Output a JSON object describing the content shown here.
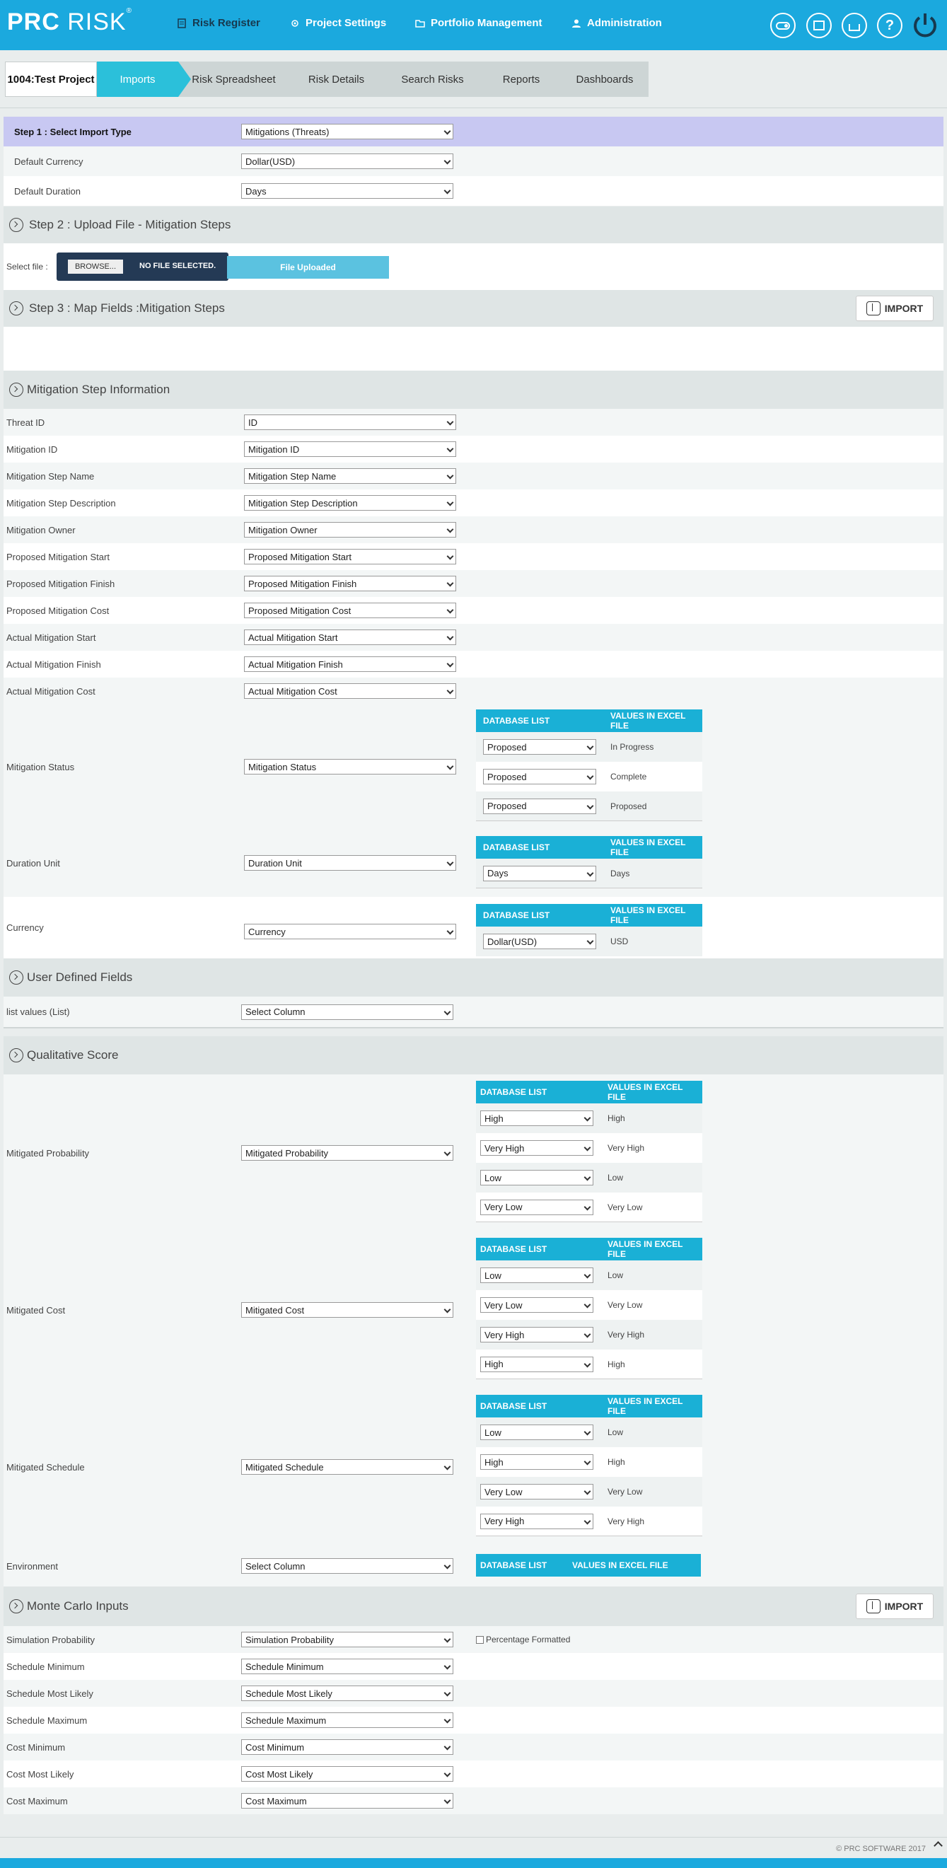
{
  "app": {
    "logo_bold": "PRC",
    "logo_light": "RISK",
    "logo_reg": "®"
  },
  "nav": [
    {
      "label": "Risk Register"
    },
    {
      "label": "Project Settings"
    },
    {
      "label": "Portfolio Management"
    },
    {
      "label": "Administration"
    }
  ],
  "breadcrumb": {
    "project": "1004:Test Project",
    "tabs": [
      "Imports",
      "Risk Spreadsheet",
      "Risk Details",
      "Search Risks",
      "Reports",
      "Dashboards"
    ]
  },
  "step1": {
    "title": "Step 1 : Select Import Type",
    "import_type": "Mitigations (Threats)",
    "currency_label": "Default Currency",
    "currency": "Dollar(USD)",
    "duration_label": "Default Duration",
    "duration": "Days"
  },
  "step2": {
    "title": "Step 2 : Upload File - Mitigation Steps",
    "select_file_label": "Select file :",
    "browse": "BROWSE...",
    "no_file": "NO FILE SELECTED.",
    "uploaded": "File Uploaded"
  },
  "step3": {
    "title": "Step 3 : Map Fields :Mitigation Steps",
    "import": "IMPORT"
  },
  "mitigation_info": {
    "title": "Mitigation Step Information",
    "fields": [
      {
        "label": "Threat ID",
        "value": "ID"
      },
      {
        "label": "Mitigation ID",
        "value": "Mitigation ID"
      },
      {
        "label": "Mitigation Step Name",
        "value": "Mitigation Step Name"
      },
      {
        "label": "Mitigation Step Description",
        "value": "Mitigation Step Description"
      },
      {
        "label": "Mitigation Owner",
        "value": "Mitigation Owner"
      },
      {
        "label": "Proposed Mitigation Start",
        "value": "Proposed Mitigation Start"
      },
      {
        "label": "Proposed Mitigation Finish",
        "value": "Proposed Mitigation Finish"
      },
      {
        "label": "Proposed Mitigation Cost",
        "value": "Proposed Mitigation Cost"
      },
      {
        "label": "Actual Mitigation Start",
        "value": "Actual Mitigation Start"
      },
      {
        "label": "Actual Mitigation Finish",
        "value": "Actual Mitigation Finish"
      },
      {
        "label": "Actual Mitigation Cost",
        "value": "Actual Mitigation Cost"
      }
    ],
    "status": {
      "label": "Mitigation Status",
      "value": "Mitigation Status",
      "map": [
        [
          "Proposed",
          "In Progress"
        ],
        [
          "Proposed",
          "Complete"
        ],
        [
          "Proposed",
          "Proposed"
        ]
      ]
    },
    "duration_unit": {
      "label": "Duration Unit",
      "value": "Duration Unit",
      "map": [
        [
          "Days",
          "Days"
        ]
      ]
    },
    "currency": {
      "label": "Currency",
      "value": "Currency",
      "map": [
        [
          "Dollar(USD)",
          "USD"
        ]
      ]
    }
  },
  "map_headers": {
    "db": "DATABASE LIST",
    "excel": "VALUES IN EXCEL FILE"
  },
  "udf": {
    "title": "User Defined Fields",
    "fields": [
      {
        "label": "list values (List)",
        "value": "Select Column"
      }
    ]
  },
  "qualitative": {
    "title": "Qualitative Score",
    "probability": {
      "label": "Mitigated Probability",
      "value": "Mitigated Probability",
      "map": [
        [
          "High",
          "High"
        ],
        [
          "Very High",
          "Very High"
        ],
        [
          "Low",
          "Low"
        ],
        [
          "Very Low",
          "Very Low"
        ]
      ]
    },
    "cost": {
      "label": "Mitigated Cost",
      "value": "Mitigated Cost",
      "map": [
        [
          "Low",
          "Low"
        ],
        [
          "Very Low",
          "Very Low"
        ],
        [
          "Very High",
          "Very High"
        ],
        [
          "High",
          "High"
        ]
      ]
    },
    "schedule": {
      "label": "Mitigated Schedule",
      "value": "Mitigated Schedule",
      "map": [
        [
          "Low",
          "Low"
        ],
        [
          "High",
          "High"
        ],
        [
          "Very Low",
          "Very Low"
        ],
        [
          "Very High",
          "Very High"
        ]
      ]
    },
    "environment": {
      "label": "Environment",
      "value": "Select Column"
    }
  },
  "monte_carlo": {
    "title": "Monte Carlo Inputs",
    "import": "IMPORT",
    "pct_label": "Percentage Formatted",
    "fields": [
      {
        "label": "Simulation Probability",
        "value": "Simulation Probability"
      },
      {
        "label": "Schedule Minimum",
        "value": "Schedule Minimum"
      },
      {
        "label": "Schedule Most Likely",
        "value": "Schedule Most Likely"
      },
      {
        "label": "Schedule Maximum",
        "value": "Schedule Maximum"
      },
      {
        "label": "Cost Minimum",
        "value": "Cost Minimum"
      },
      {
        "label": "Cost Most Likely",
        "value": "Cost Most Likely"
      },
      {
        "label": "Cost Maximum",
        "value": "Cost Maximum"
      }
    ]
  },
  "footer": {
    "copyright": "© PRC SOFTWARE 2017"
  }
}
